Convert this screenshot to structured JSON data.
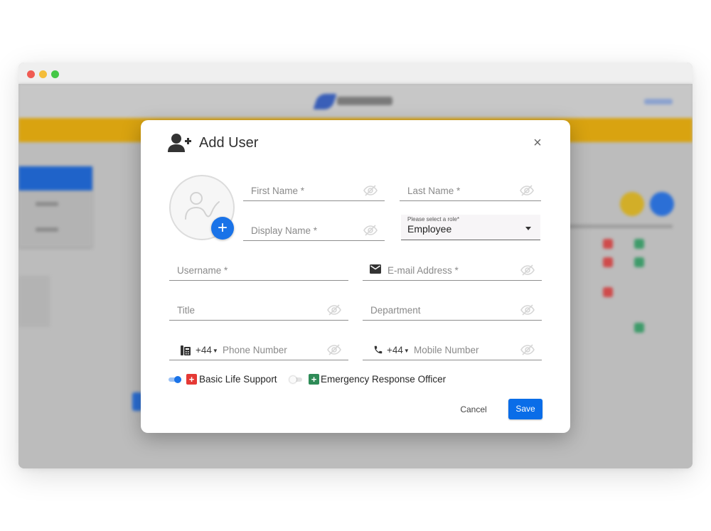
{
  "window": {
    "controls": [
      "close",
      "minimize",
      "maximize"
    ]
  },
  "dialog": {
    "title": "Add User",
    "header_icon": "add-user-icon",
    "close_label": "×"
  },
  "avatar": {
    "icon": "signature-placeholder-icon",
    "add_label": "+"
  },
  "fields": {
    "first_name": {
      "placeholder": "First Name *",
      "value": ""
    },
    "last_name": {
      "placeholder": "Last Name *",
      "value": ""
    },
    "display_name": {
      "placeholder": "Display Name *",
      "value": ""
    },
    "role": {
      "label": "Please select a role*",
      "value": "Employee"
    },
    "username": {
      "placeholder": "Username *",
      "value": ""
    },
    "email": {
      "placeholder": "E-mail Address *",
      "value": ""
    },
    "title": {
      "placeholder": "Title",
      "value": ""
    },
    "department": {
      "placeholder": "Department",
      "value": ""
    },
    "phone": {
      "country_code": "+44",
      "placeholder": "Phone Number",
      "value": ""
    },
    "mobile": {
      "country_code": "+44",
      "placeholder": "Mobile Number",
      "value": ""
    }
  },
  "certifications": [
    {
      "label": "Basic Life Support",
      "enabled": true,
      "badge_color": "#e53935",
      "badge_symbol": "+"
    },
    {
      "label": "Emergency Response Officer",
      "enabled": false,
      "badge_color": "#2e8b57",
      "badge_symbol": "+"
    }
  ],
  "actions": {
    "cancel": "Cancel",
    "save": "Save"
  },
  "colors": {
    "accent": "#0a6de8",
    "banner": "#d9a310"
  }
}
